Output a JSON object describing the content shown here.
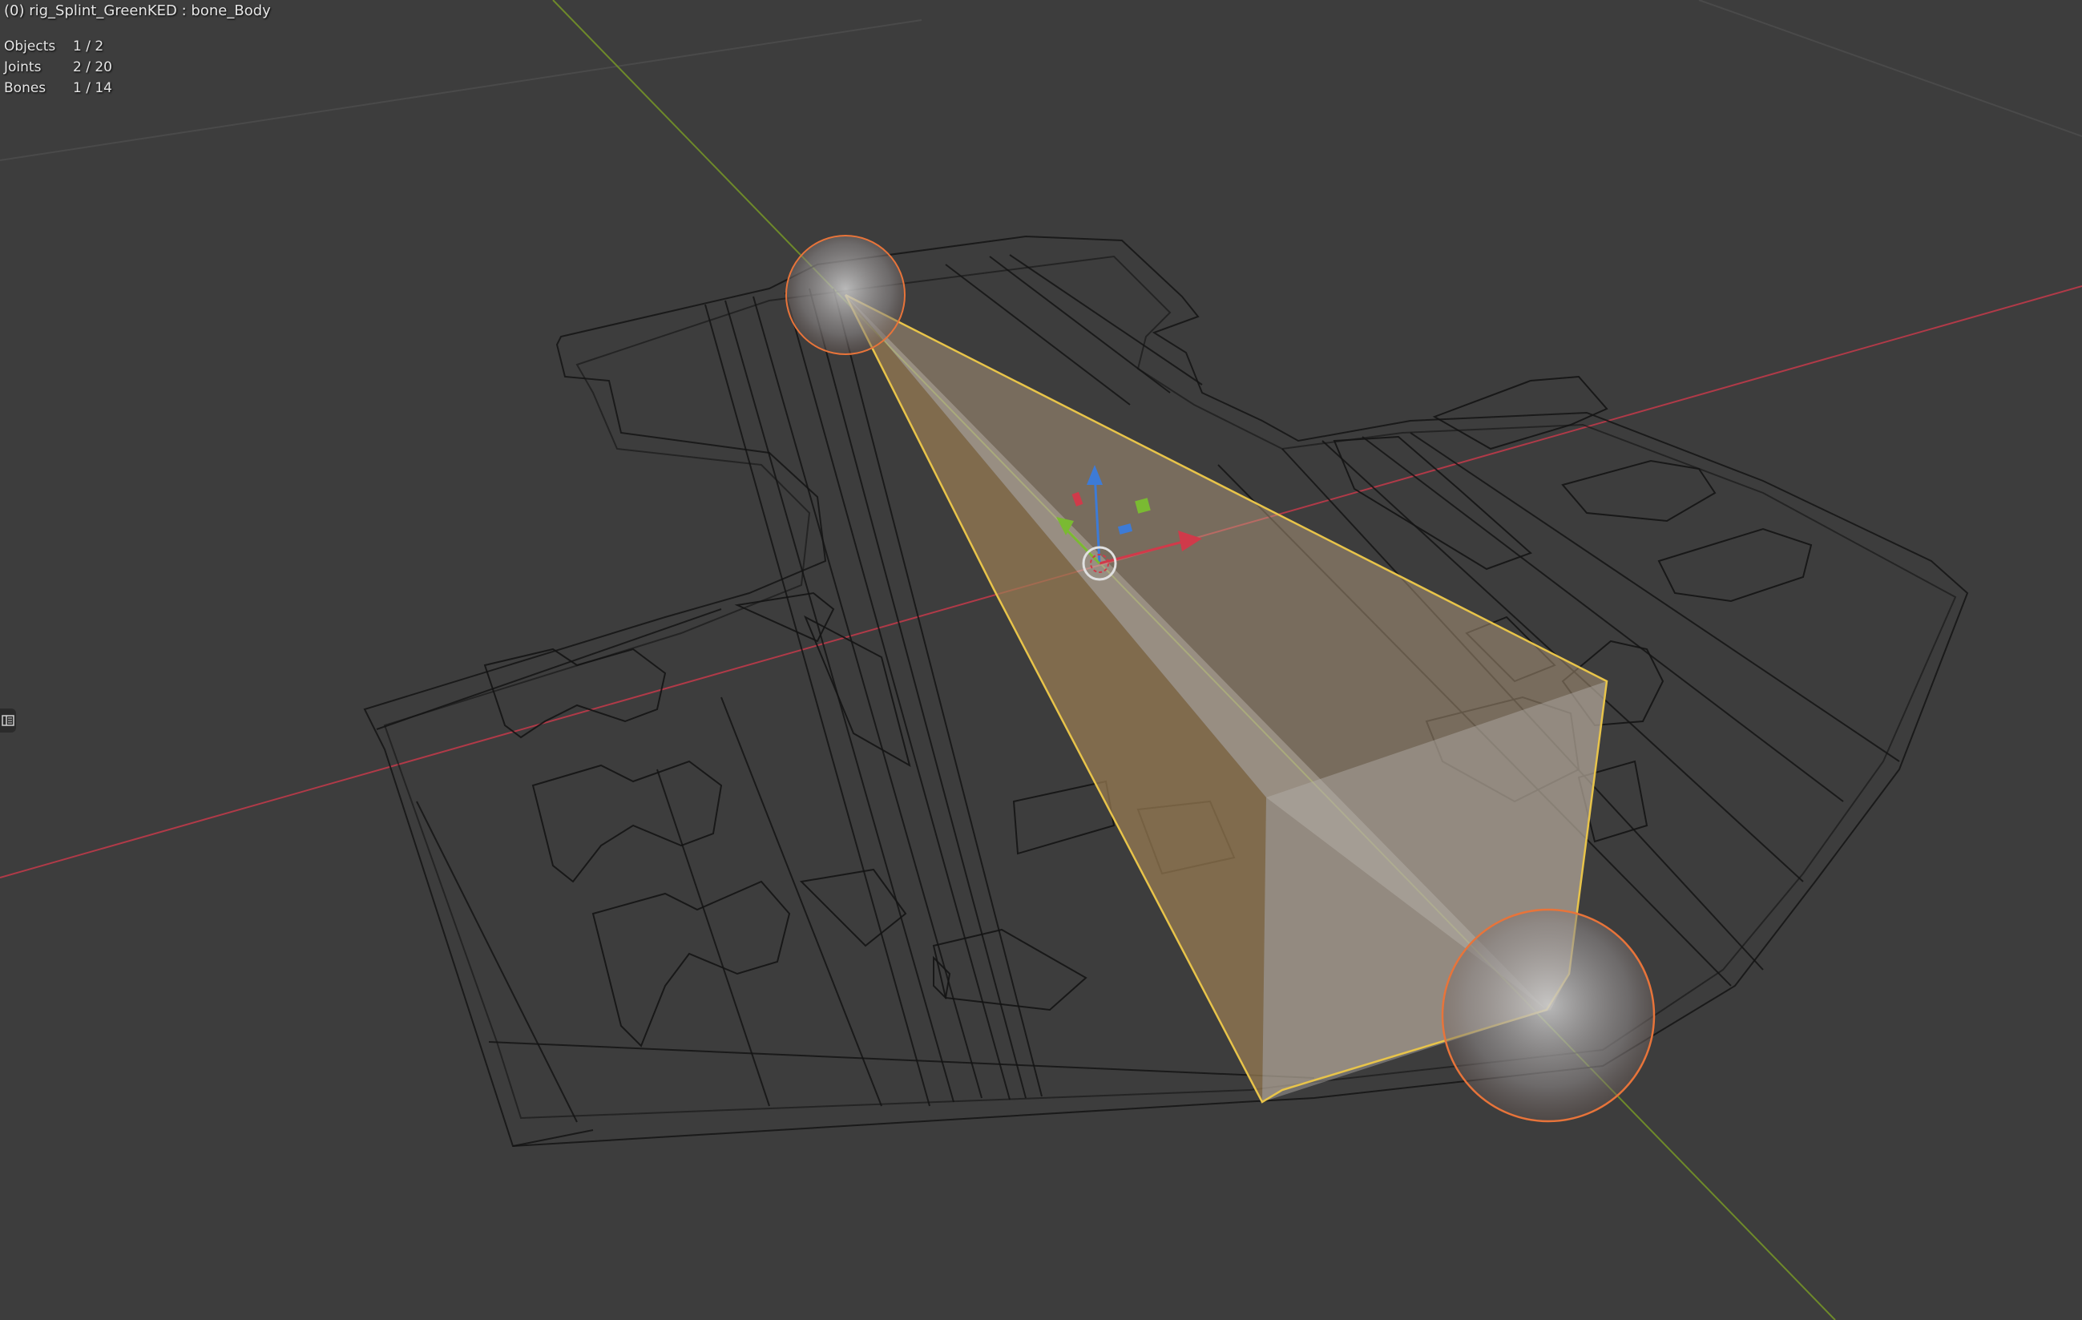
{
  "header": {
    "title": "(0) rig_Splint_GreenKED : bone_Body"
  },
  "stats": [
    {
      "label": "Objects",
      "value": "1 / 2"
    },
    {
      "label": "Joints",
      "value": "2 / 20"
    },
    {
      "label": "Bones",
      "value": "1 / 14"
    }
  ],
  "colors": {
    "background": "#3d3d3d",
    "x_axis": "#b03a48",
    "y_axis": "#7a9a2a",
    "bone_outline": "#e8c44a",
    "joint_outline": "#e8743a",
    "wire": "#101010"
  },
  "icons": {
    "gizmo": "transform-gizmo-icon",
    "side_tab": "sidebar-toggle-icon"
  }
}
